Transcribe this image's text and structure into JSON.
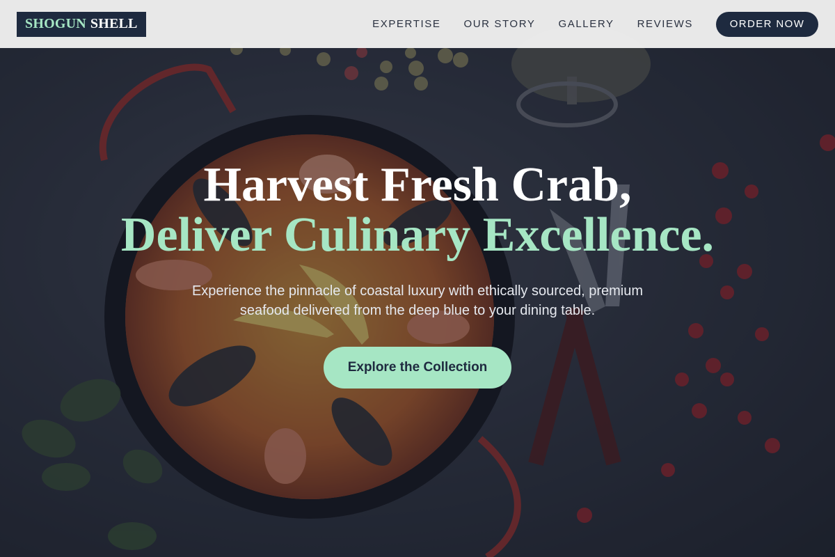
{
  "brand": {
    "name_part1": "SHOGUN",
    "name_part2": "SHELL"
  },
  "nav": {
    "links": [
      "EXPERTISE",
      "OUR STORY",
      "GALLERY",
      "REVIEWS"
    ],
    "cta_label": "ORDER NOW"
  },
  "hero": {
    "headline_line1": "Harvest Fresh Crab,",
    "headline_line2": "Deliver Culinary Excellence.",
    "subtitle": "Experience the pinnacle of coastal luxury with ethically sourced, premium seafood delivered from the deep blue to your dining table.",
    "cta_label": "Explore the Collection",
    "background_image": "paella-seafood-pan-on-slate-with-cutlery-and-berries"
  },
  "colors": {
    "accent_mint": "#a6e6c4",
    "navy": "#1e2a3f",
    "nav_bg": "#f0f0f0",
    "text_white": "#ffffff"
  }
}
